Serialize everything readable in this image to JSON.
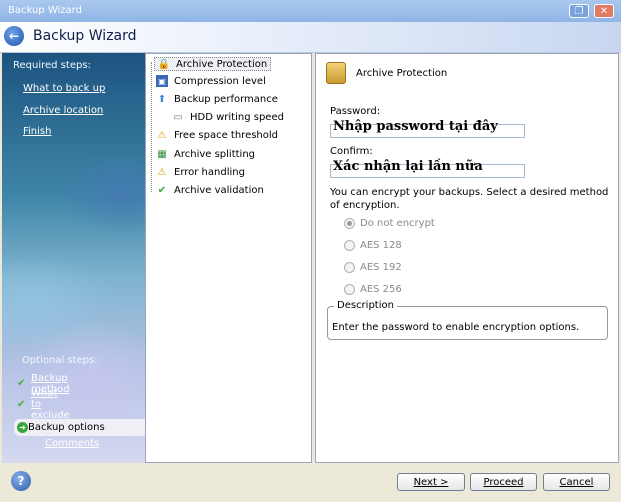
{
  "window": {
    "title": "Backup Wizard",
    "restore_glyph": "❐",
    "close_glyph": "✕"
  },
  "header": {
    "title": "Backup Wizard"
  },
  "left": {
    "required_heading": "Required steps:",
    "required": [
      "What to back up",
      "Archive location",
      "Finish"
    ],
    "optional_heading": "Optional steps:",
    "optional": [
      {
        "label": "Backup method",
        "state": "done"
      },
      {
        "label": "What to exclude",
        "state": "done"
      },
      {
        "label": "Backup options",
        "state": "active"
      },
      {
        "label": "Comments",
        "state": "none"
      }
    ]
  },
  "tree": {
    "items": [
      {
        "label": "Archive Protection",
        "icon": "lock-icon",
        "selected": true
      },
      {
        "label": "Compression level",
        "icon": "compression-icon"
      },
      {
        "label": "Backup performance",
        "icon": "arrow-up-icon"
      },
      {
        "label": "HDD writing speed",
        "icon": "hdd-icon"
      },
      {
        "label": "Free space threshold",
        "icon": "warning-icon"
      },
      {
        "label": "Archive splitting",
        "icon": "split-icon"
      },
      {
        "label": "Error handling",
        "icon": "warning-icon"
      },
      {
        "label": "Archive validation",
        "icon": "checkmark-icon"
      }
    ]
  },
  "panel": {
    "title": "Archive Protection",
    "password_label": "Password:",
    "password_overlay": "Nhập password tại đây",
    "confirm_label": "Confirm:",
    "confirm_overlay": "Xác nhận lại lần nữa",
    "description_text": "You can encrypt your backups. Select a desired method of encryption.",
    "options": [
      "Do not encrypt",
      "AES 128",
      "AES 192",
      "AES 256"
    ],
    "selected_option": "Do not encrypt",
    "fieldset_title": "Description",
    "fieldset_text": "Enter the password to enable encryption options."
  },
  "buttons": {
    "help": "?",
    "next": "Next >",
    "proceed": "Proceed",
    "cancel": "Cancel"
  },
  "colors": {
    "accent_link": "#ffffff",
    "check_green": "#43b043"
  }
}
